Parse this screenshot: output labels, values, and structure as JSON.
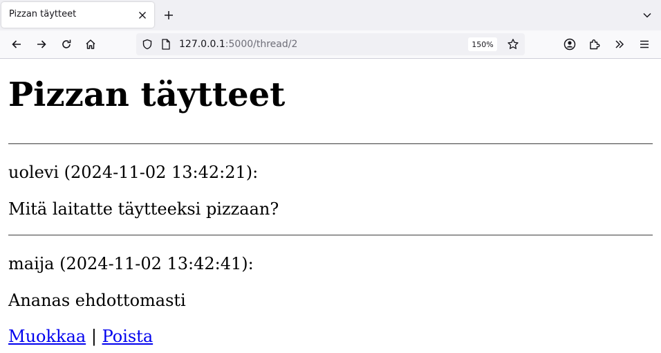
{
  "browser": {
    "tab": {
      "title": "Pizzan täytteet"
    },
    "url": {
      "host": "127.0.0.1",
      "rest": ":5000/thread/2"
    },
    "zoom": "150%",
    "icons": {
      "close": "close-icon",
      "new_tab": "plus-icon",
      "tab_list": "chevron-down-icon",
      "back": "arrow-left-icon",
      "forward": "arrow-right-icon",
      "reload": "reload-icon",
      "home": "home-icon",
      "shield": "shield-icon",
      "page": "page-icon",
      "star": "star-icon",
      "account": "account-icon",
      "extensions": "puzzle-icon",
      "overflow": "double-chevron-icon",
      "menu": "hamburger-icon"
    }
  },
  "page": {
    "title": "Pizzan täytteet",
    "messages": [
      {
        "header": "uolevi (2024-11-02 13:42:21):",
        "body": "Mitä laitatte täytteeksi pizzaan?"
      },
      {
        "header": "maija (2024-11-02 13:42:41):",
        "body": "Ananas ehdottomasti"
      }
    ],
    "actions": {
      "edit": "Muokkaa",
      "separator": "|",
      "delete": "Poista"
    }
  },
  "colors": {
    "link": "#0000ee",
    "tabstrip": "#f0f0f4",
    "toolbar": "#f9f9fb"
  }
}
